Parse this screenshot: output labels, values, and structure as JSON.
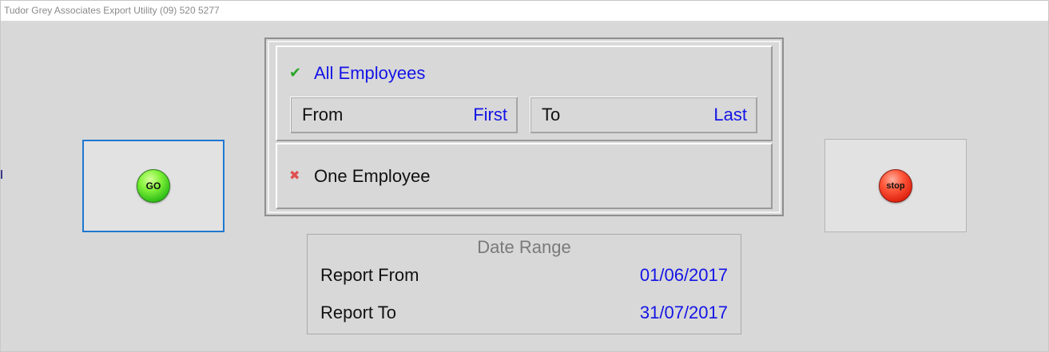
{
  "window": {
    "title": "Tudor Grey Associates Export Utility (09) 520 5277"
  },
  "buttons": {
    "go_label": "GO",
    "stop_label": "stop"
  },
  "employees": {
    "all_label": "All Employees",
    "all_selected": true,
    "from_label": "From",
    "from_value": "First",
    "to_label": "To",
    "to_value": "Last",
    "one_label": "One Employee",
    "one_selected": false
  },
  "date_range": {
    "title": "Date Range",
    "report_from_label": "Report From",
    "report_from_value": "01/06/2017",
    "report_to_label": "Report To",
    "report_to_value": "31/07/2017"
  },
  "colors": {
    "accent_blue": "#1414e6",
    "focus_border": "#1e78d0",
    "check_green": "#2aa52a",
    "cross_red": "#e05050"
  },
  "icons": {
    "selected": "check-icon",
    "unselected": "cross-icon"
  }
}
